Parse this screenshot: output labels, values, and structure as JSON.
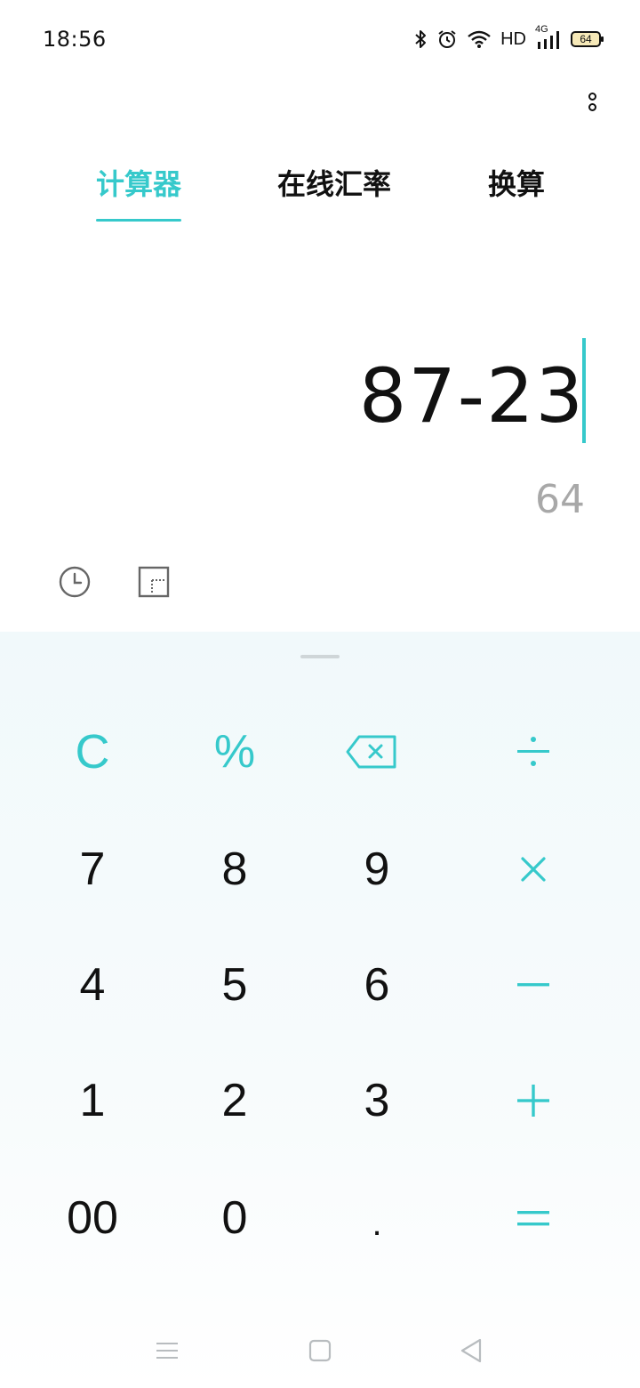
{
  "status_bar": {
    "time": "18:56",
    "network_label": "HD",
    "network_type": "4G",
    "battery_level": "64",
    "icons": [
      "bluetooth-icon",
      "alarm-icon",
      "wifi-icon",
      "signal-icon",
      "battery-icon"
    ]
  },
  "tabs": [
    {
      "label": "计算器",
      "active": true
    },
    {
      "label": "在线汇率",
      "active": false
    },
    {
      "label": "换算",
      "active": false
    }
  ],
  "display": {
    "expression": "87-23",
    "result": "64"
  },
  "tools": [
    "history-icon",
    "scientific-mode-icon"
  ],
  "keypad": {
    "row1": [
      "C",
      "%",
      "backspace-icon",
      "÷"
    ],
    "row2": [
      "7",
      "8",
      "9",
      "×"
    ],
    "row3": [
      "4",
      "5",
      "6",
      "−"
    ],
    "row4": [
      "1",
      "2",
      "3",
      "+"
    ],
    "row5": [
      "00",
      "0",
      ".",
      "="
    ]
  },
  "colors": {
    "accent": "#36c9cb",
    "result_text": "#a8a8a8",
    "keypad_bg": "#f1f9fb"
  },
  "nav_bar": [
    "menu-icon",
    "home-icon",
    "back-icon"
  ]
}
